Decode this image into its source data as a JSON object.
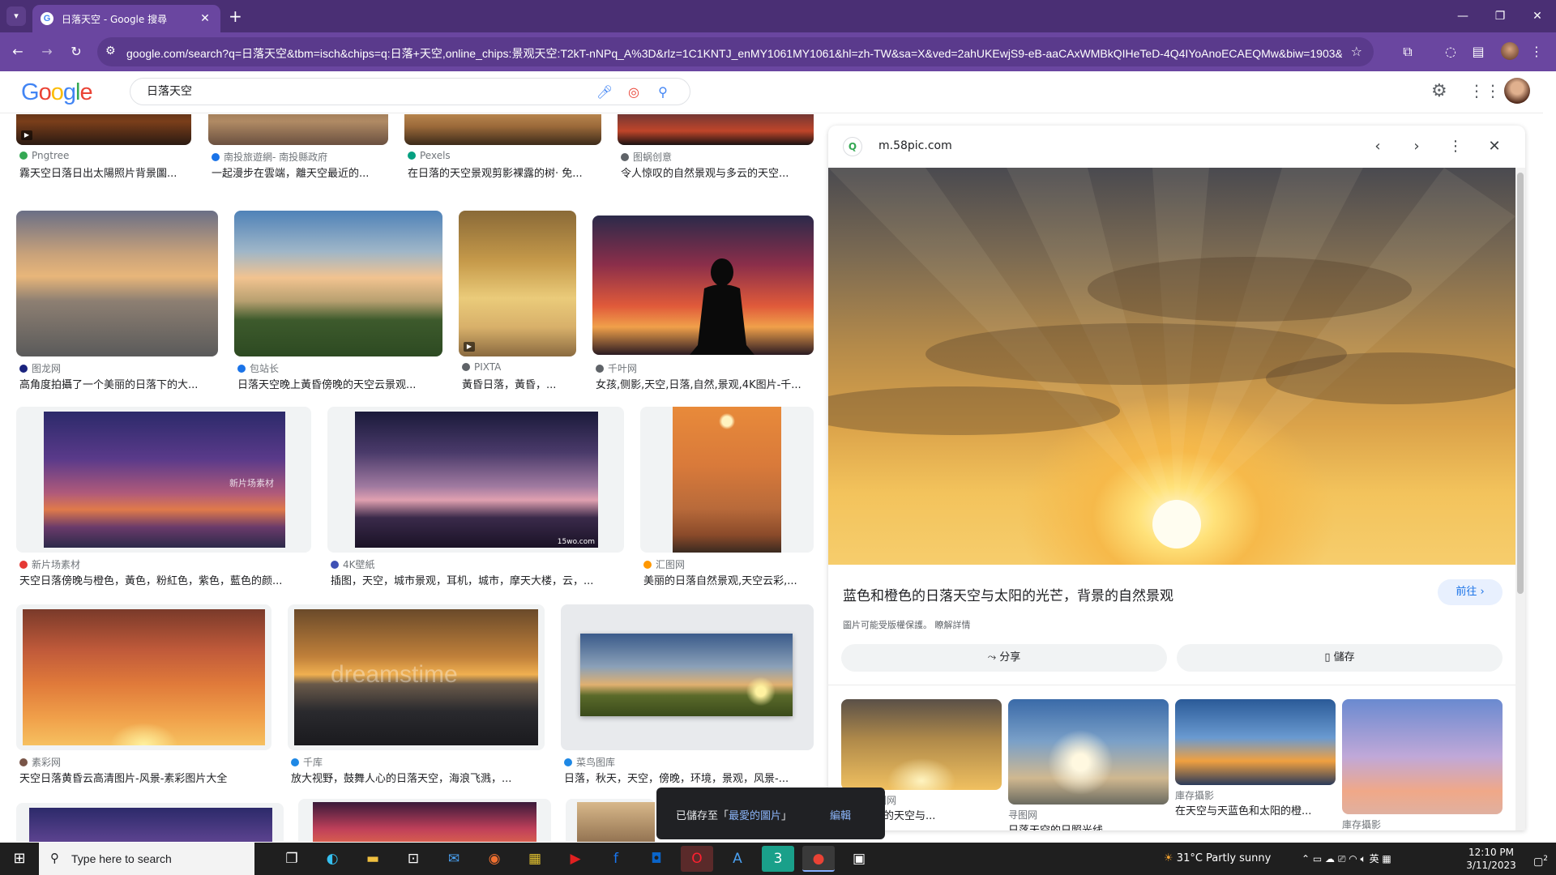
{
  "browser": {
    "tab_title": "日落天空 - Google 搜尋",
    "url": "google.com/search?q=日落天空&tbm=isch&chips=q:日落+天空,online_chips:景观天空:T2kT-nNPq_A%3D&rlz=1C1KNTJ_enMY1061MY1061&hl=zh-TW&sa=X&ved=2ahUKEwjS9-eB-aaCAxWMBkQIHeTeD-4Q4IYoAnoECAEQMw&biw=1903&bih...",
    "new_tab": "+",
    "minimize": "—",
    "restore": "❐",
    "close": "✕"
  },
  "google": {
    "logo": [
      "G",
      "o",
      "o",
      "g",
      "l",
      "e"
    ],
    "logo_colors": [
      "#4285f4",
      "#ea4335",
      "#fbbc05",
      "#4285f4",
      "#34a853",
      "#ea4335"
    ],
    "search_value": "日落天空"
  },
  "results": [
    {
      "source": "Pngtree",
      "caption": "霧天空日落日出太陽照片背景圖...",
      "src_color": "#34a853"
    },
    {
      "source": "南投旅遊網- 南投縣政府",
      "caption": "一起漫步在雲端，離天空最近的...",
      "src_color": "#1a73e8"
    },
    {
      "source": "Pexels",
      "caption": "在日落的天空景观剪影裸露的树· 免...",
      "src_color": "#05a081"
    },
    {
      "source": "图蜗创意",
      "caption": "令人惊叹的自然景观与多云的天空...",
      "src_color": "#5f6368"
    },
    {
      "source": "图龙网",
      "caption": "高角度拍攝了一个美丽的日落下的大...",
      "src_color": "#1a237e"
    },
    {
      "source": "包站长",
      "caption": "日落天空晚上黃昏傍晚的天空云景观...",
      "src_color": "#1a73e8"
    },
    {
      "source": "PIXTA",
      "caption": "黃昏日落，黃昏，...",
      "src_color": "#5f6368"
    },
    {
      "source": "千叶网",
      "caption": "女孩,侧影,天空,日落,自然,景观,4K图片-千...",
      "src_color": "#5f6368"
    },
    {
      "source": "新片场素材",
      "caption": "天空日落傍晚与橙色，黃色，粉紅色，紫色，藍色的颜...",
      "src_color": "#e53935"
    },
    {
      "source": "4K壁紙",
      "caption": "插图，天空，城市景观，耳机，城市，摩天大楼，云，...",
      "src_color": "#3f51b5"
    },
    {
      "source": "汇图网",
      "caption": "美丽的日落自然景观,天空云彩,...",
      "src_color": "#ff9800"
    },
    {
      "source": "素彩网",
      "caption": "天空日落黄昏云高清图片-风景-素彩图片大全",
      "src_color": "#795548"
    },
    {
      "source": "千库",
      "caption": "放大视野，鼓舞人心的日落天空，海浪飞溅，...",
      "src_color": "#1e88e5"
    },
    {
      "source": "菜鸟图库",
      "caption": "日落，秋天，天空，傍晚，环境，景观，风景-...",
      "src_color": "#1e88e5"
    }
  ],
  "watermarks": {
    "xinpianchang": "新片场素材",
    "w15": "15wo.com",
    "dreamstime": "dreamstime"
  },
  "panel": {
    "domain": "m.58pic.com",
    "title": "蓝色和橙色的日落天空与太阳的光芒，背景的自然景观",
    "visit": "前往",
    "copyright": "圖片可能受版權保護。 瞭解詳情",
    "share": "分享",
    "save": "儲存",
    "related": [
      {
        "source": "视界- 摄图网",
        "caption": "色的夕阳的天空与..."
      },
      {
        "source": "寻图网",
        "caption": "日落天空的日照光线..."
      },
      {
        "source": "庫存攝影",
        "caption": "在天空与天蓝色和太阳的橙..."
      },
      {
        "source": "庫存攝影",
        "caption": ""
      }
    ]
  },
  "toast": {
    "prefix": "已儲存至「",
    "link": "最愛的圖片",
    "suffix": "」",
    "edit": "編輯"
  },
  "taskbar": {
    "search_placeholder": "Type here to search",
    "weather": "31°C  Partly sunny",
    "lang": "英",
    "time": "12:10 PM",
    "date": "3/11/2023",
    "notifications": "2"
  }
}
